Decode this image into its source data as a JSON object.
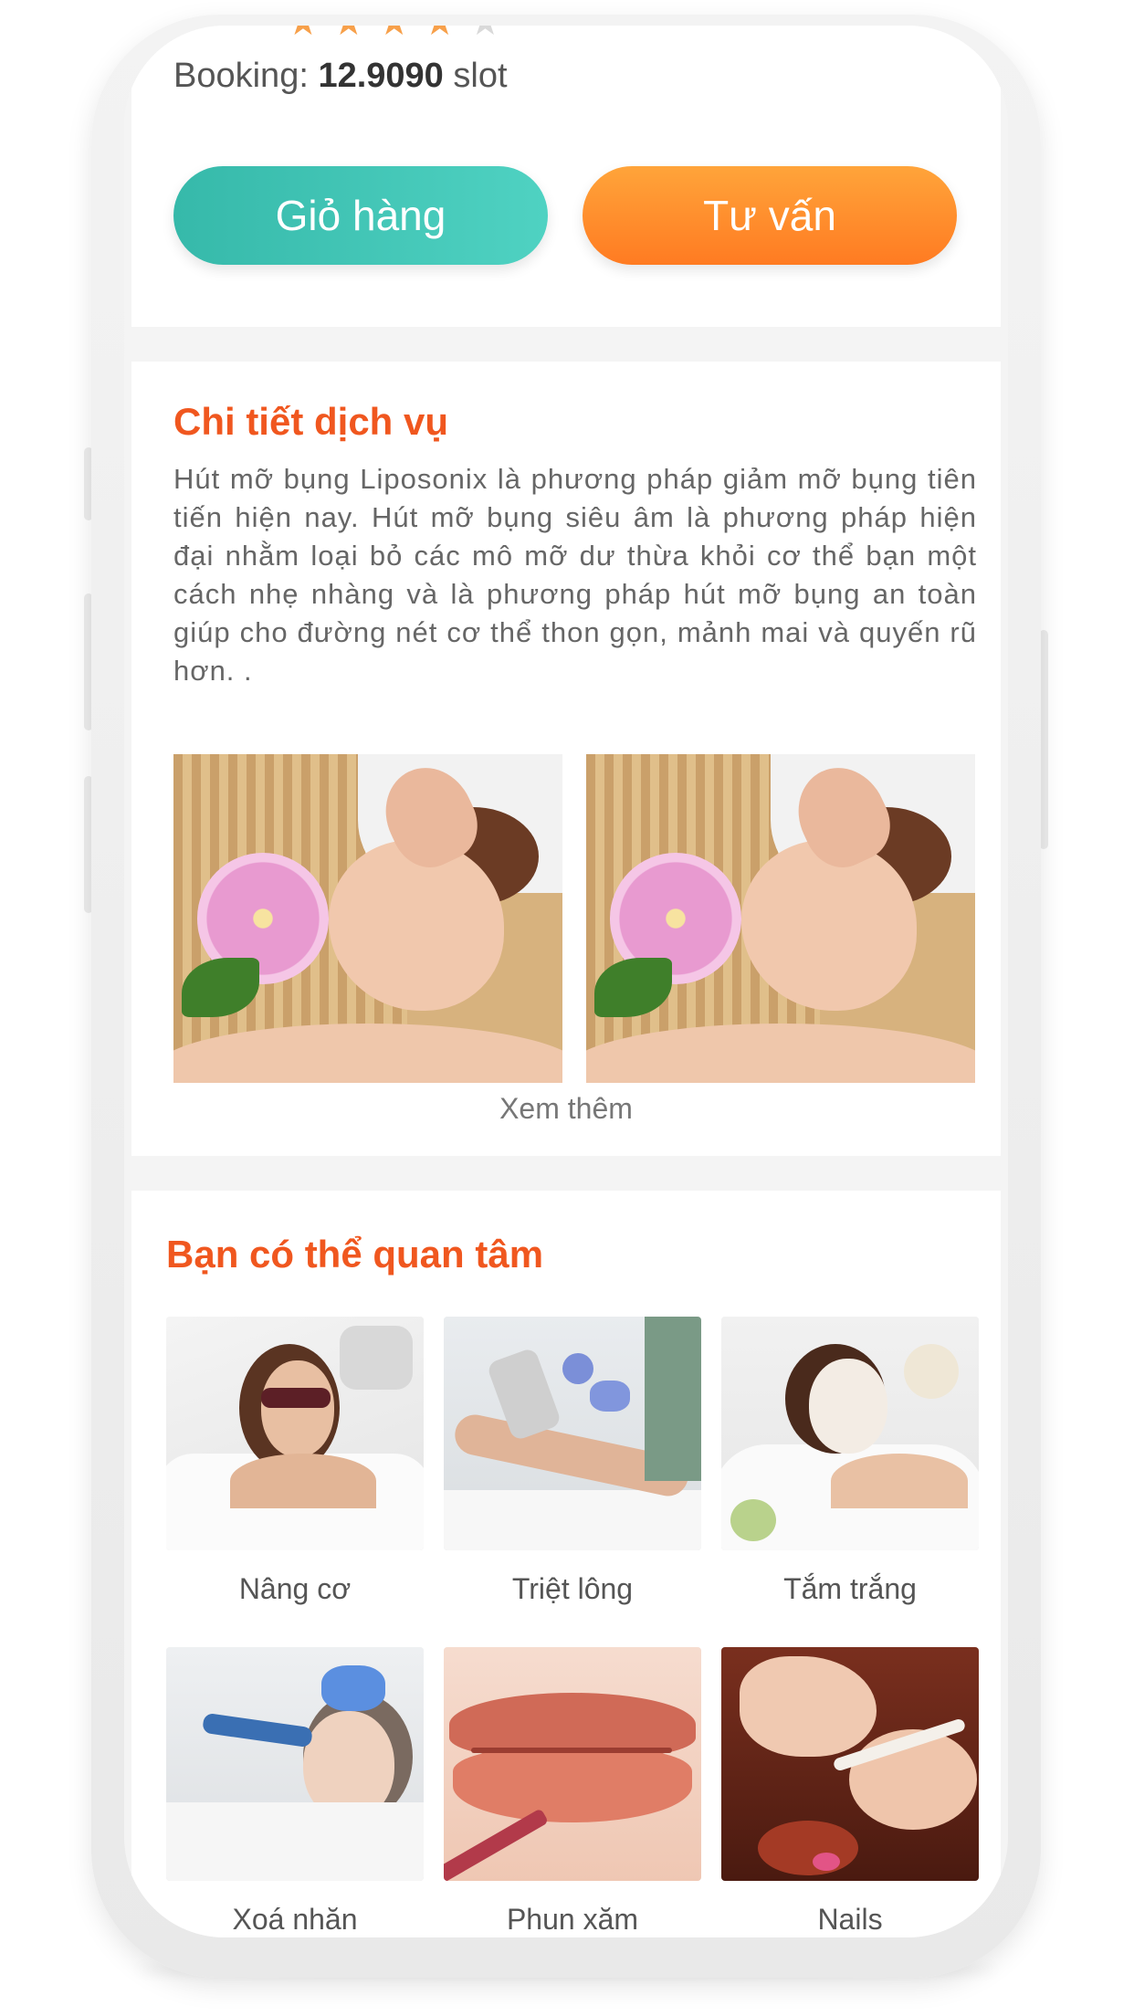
{
  "product": {
    "rating_stars": 4,
    "rating_max": 5,
    "booking_label": "Booking:",
    "booking_value": "12.9090",
    "booking_unit": "slot",
    "cart_button": "Giỏ hàng",
    "consult_button": "Tư vấn"
  },
  "details": {
    "title": "Chi  tiết dịch  vụ",
    "description": "Hút mỡ bụng Liposonix là phương pháp giảm mỡ bụng tiên tiến hiện nay. Hút mỡ bụng siêu âm là phương pháp hiện đại nhằm loại bỏ các mô mỡ dư thừa khỏi cơ thể bạn một cách nhẹ nhàng và là phương pháp hút mỡ bụng an toàn giúp cho đường nét cơ thể thon gọn, mảnh mai và quyến rũ hơn. .",
    "see_more": "Xem thêm"
  },
  "related": {
    "title": "Bạn có thể quan tâm",
    "items": [
      {
        "label": "Nâng cơ"
      },
      {
        "label": "Triệt lông"
      },
      {
        "label": "Tắm trắng"
      },
      {
        "label": "Xoá nhăn"
      },
      {
        "label": "Phun xăm"
      },
      {
        "label": "Nails"
      }
    ]
  },
  "colors": {
    "teal": "#3cc2b2",
    "orange": "#ff8a2a",
    "section_title": "#f0571f",
    "star": "#f7a04a"
  }
}
